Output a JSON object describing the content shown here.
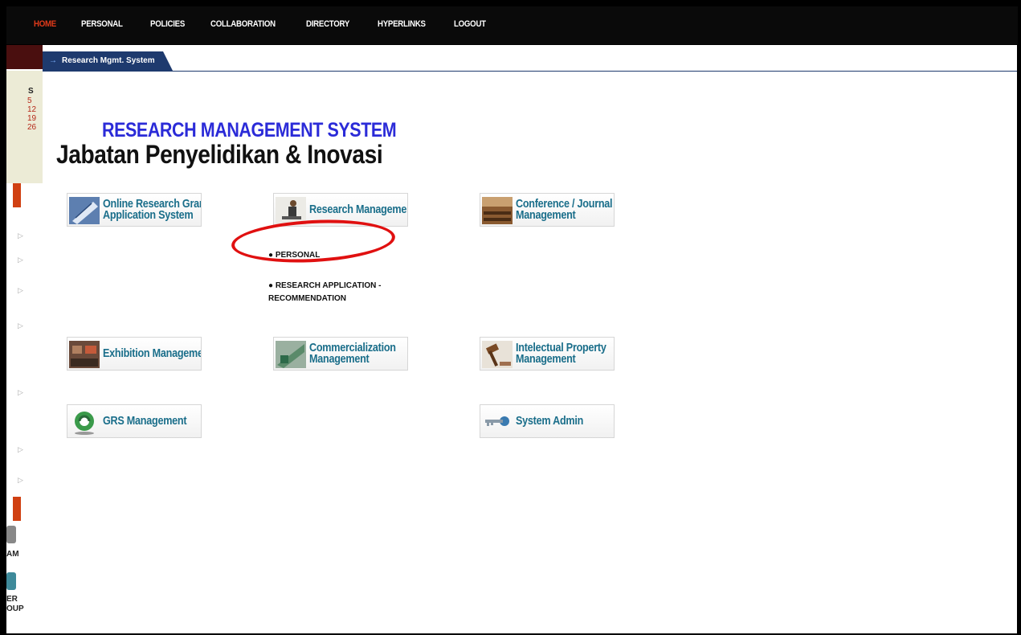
{
  "nav": {
    "items": [
      {
        "label": "HOME",
        "active": true
      },
      {
        "label": "PERSONAL"
      },
      {
        "label": "POLICIES"
      },
      {
        "label": "COLLABORATION"
      },
      {
        "label": "DIRECTORY"
      },
      {
        "label": "HYPERLINKS"
      },
      {
        "label": "LOGOUT"
      }
    ]
  },
  "sidebar": {
    "calendar": {
      "day_header": "S",
      "dates": [
        "5",
        "12",
        "19",
        "26"
      ]
    },
    "text_fragments": [
      "AM",
      "ER",
      "OUP"
    ]
  },
  "breadcrumb_tab": "Research Mgmt. System",
  "heading": {
    "line1": "RESEARCH MANAGEMENT SYSTEM",
    "line2": "Jabatan Penyelidikan & Inovasi"
  },
  "tiles": [
    {
      "name": "online-research-grant",
      "label_lines": [
        "Online Research Grant",
        "Application System"
      ],
      "icon": "research-paper-icon"
    },
    {
      "name": "research-management",
      "label_lines": [
        "Research Management"
      ],
      "icon": "researcher-icon"
    },
    {
      "name": "conference-journal",
      "label_lines": [
        "Conference / Journal",
        "Management"
      ],
      "icon": "conference-hall-icon"
    },
    {
      "name": "exhibition-management",
      "label_lines": [
        "Exhibition Management"
      ],
      "icon": "exhibition-icon"
    },
    {
      "name": "commercialization-management",
      "label_lines": [
        "Commercialization",
        "Management"
      ],
      "icon": "commercialization-icon"
    },
    {
      "name": "intelectual-property",
      "label_lines": [
        "Intelectual Property",
        "Management"
      ],
      "icon": "gavel-icon"
    },
    {
      "name": "grs-management",
      "label_lines": [
        "GRS Management"
      ],
      "icon": "grs-icon"
    },
    {
      "name": "system-admin",
      "label_lines": [
        "System Admin"
      ],
      "icon": "keys-icon"
    }
  ],
  "research_menu": {
    "item1": "PERSONAL",
    "item2_line1": "RESEARCH APPLICATION -",
    "item2_line2": "RECOMMENDATION"
  },
  "colors": {
    "accent_red": "#e03a1a",
    "nav_bg": "#0a0a0a",
    "tab_blue": "#1e3a6e",
    "title_blue": "#2b2bd8",
    "tile_text": "#1a6e8a",
    "highlight_circle": "#e01010"
  }
}
